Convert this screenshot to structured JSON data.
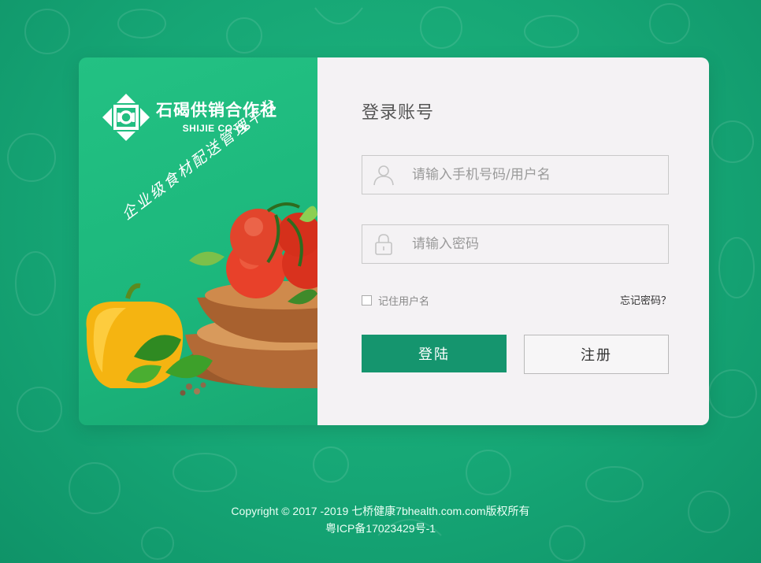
{
  "brand": {
    "name": "石碣供销合作社",
    "name_en": "SHIJIE CO-OP",
    "slogan": "企业级食材配送管理平台"
  },
  "login": {
    "title": "登录账号",
    "username_placeholder": "请输入手机号码/用户名",
    "username_value": "",
    "password_placeholder": "请输入密码",
    "password_value": "",
    "remember_label": "记住用户名",
    "remember_checked": false,
    "forgot_label": "忘记密码？",
    "login_button": "登陆",
    "register_button": "注册",
    "icons": {
      "username": "user-icon",
      "password": "lock-icon"
    }
  },
  "footer": {
    "copyright": "Copyright © 2017 -2019 七桥健康7bhealth.com.com版权所有",
    "icp": "粤ICP备17023429号-1"
  },
  "colors": {
    "background": "#16a675",
    "promo_panel": "#1cb77c",
    "login_panel": "#f4f2f4",
    "primary_button": "#15956e"
  }
}
